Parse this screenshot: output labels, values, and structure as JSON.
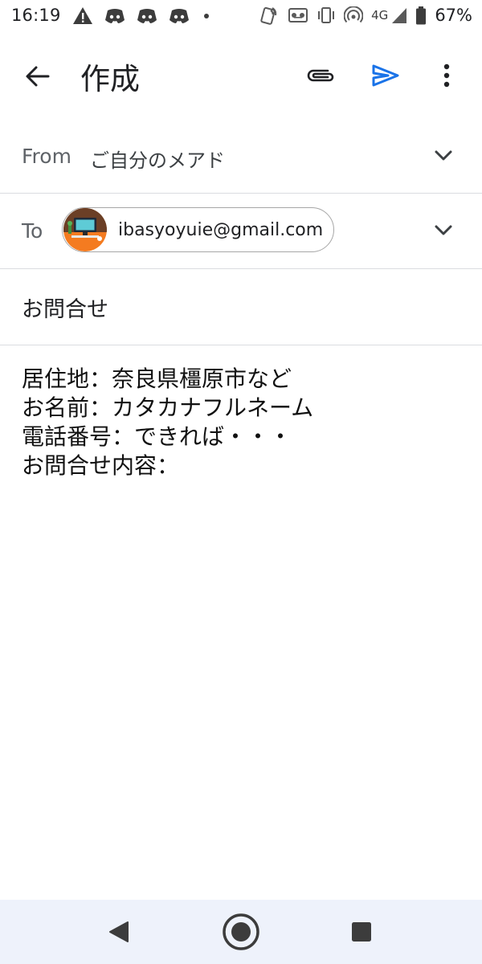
{
  "status_bar": {
    "time": "16:19",
    "network": "4G",
    "battery": "67%",
    "left_icons": [
      "warning-icon",
      "discord-icon",
      "discord-icon",
      "discord-icon",
      "dot-icon"
    ],
    "right_icons": [
      "nfc-icon",
      "voicemail-icon",
      "vibrate-icon",
      "hotspot-icon",
      "signal-icon",
      "battery-icon"
    ]
  },
  "app_bar": {
    "title": "作成",
    "icons": [
      "back-arrow-icon",
      "attach-icon",
      "send-icon",
      "more-vert-icon"
    ],
    "send_color": "#1a73e8"
  },
  "compose": {
    "from_label": "From",
    "from_value": "ご自分のメアド",
    "to_label": "To",
    "to_recipient": "ibasyoyuie@gmail.com",
    "subject": "お問合せ",
    "body_lines": [
      "居住地：奈良県橿原市など",
      "お名前：カタカナフルネーム",
      "電話番号：できれば・・・",
      "お問合せ内容："
    ]
  },
  "nav_bar": {
    "icons": [
      "nav-back-icon",
      "nav-home-icon",
      "nav-recents-icon"
    ],
    "background": "#eef2fb"
  }
}
